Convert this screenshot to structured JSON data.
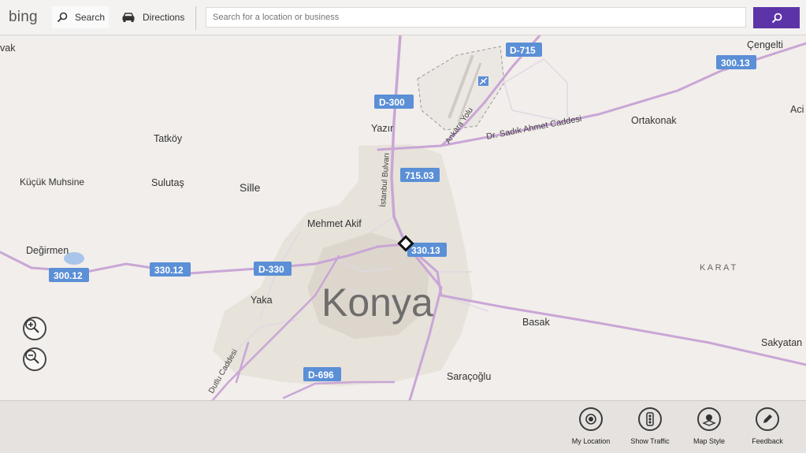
{
  "topbar": {
    "logo_text": "bing",
    "search_button_label": "Search",
    "directions_button_label": "Directions",
    "search_placeholder": "Search for a location or business",
    "search_go_icon": "search-icon"
  },
  "map": {
    "city_label": "Konya",
    "places": {
      "cengelti": "Çengelti",
      "vak": "vak",
      "aci": "Aci",
      "ortakonak": "Ortakonak",
      "yazir": "Yazır",
      "tatkoy": "Tatköy",
      "kucuk_muhsine": "Küçük Muhsine",
      "sulutas": "Sulutaş",
      "sille": "Sille",
      "mehmet_akif": "Mehmet Akif",
      "degirmen": "Değirmen",
      "yaka": "Yaka",
      "basak": "Basak",
      "sakyatan": "Sakyatan",
      "saracoglu": "Saraçoğlu",
      "karat": "K A R A T"
    },
    "roads": {
      "dr_sadik": "Dr. Sadık Ahmet Caddesi",
      "ankara_yolu": "Ankara Yolu",
      "istanbul_bulvari": "İstanbul Bulvarı",
      "dutlu": "Dutlu Caddesi"
    },
    "shields": {
      "d715": "D-715",
      "r30013_top": "300.13",
      "d300": "D-300",
      "r71503": "715.03",
      "r33013": "330.13",
      "d330": "D-330",
      "r33012": "330.12",
      "r30012": "300.12",
      "d696": "D-696"
    },
    "colors": {
      "land": "#f2eeeb",
      "road": "#c9a6d6",
      "shield": "#5b8fd6",
      "urban": "#e4dfd7",
      "water": "#a9c6ea"
    },
    "zoom_in_icon": "zoom-in-icon",
    "zoom_out_icon": "zoom-out-icon"
  },
  "appbar": {
    "my_location": "My Location",
    "show_traffic": "Show Traffic",
    "map_style": "Map Style",
    "feedback": "Feedback"
  }
}
